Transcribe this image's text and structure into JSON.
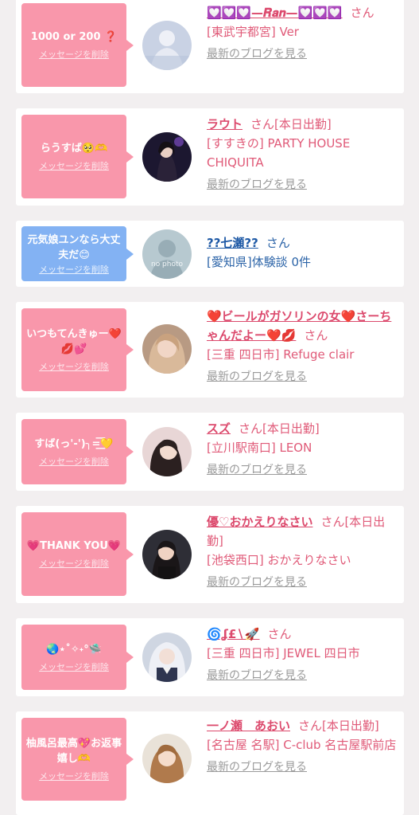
{
  "delete_label": "メッセージを削除",
  "blog_label": "最新のブログを見る",
  "san_label": "さん",
  "colors": {
    "bubble_pink": "#f997ab",
    "bubble_blue": "#83b2f3",
    "text_pink": "#e05a78",
    "text_blue": "#2c64a8"
  },
  "cards": [
    {
      "message": "1000 or 200 ❓",
      "bubble": "pink",
      "name": "💟💟💟—𝑹𝒂𝒏—💟💟💟",
      "suffix": "さん",
      "location": "[東武宇都宮] Ver",
      "avatar": "photo",
      "has_blog": true
    },
    {
      "message": "らうすば🥺🫶",
      "bubble": "pink",
      "name": "ラウト",
      "suffix": "さん[本日出勤]",
      "location": "[すすきの] PARTY HOUSE CHIQUITA",
      "avatar": "photo",
      "has_blog": true
    },
    {
      "message": "元気娘ユンなら大丈夫だ😊",
      "bubble": "blue",
      "name": "??七瀬??",
      "suffix": "さん",
      "location": "[愛知県]体験談 0件",
      "avatar": "no photo",
      "has_blog": false
    },
    {
      "message": "いつもてんきゅー❤️💋💕",
      "bubble": "pink",
      "name": "❤️ビールがガソリンの女❤️さーちゃんだよー❤️💋",
      "suffix": "さん",
      "location": "[三重 四日市] Refuge clair",
      "avatar": "photo",
      "has_blog": true
    },
    {
      "message": "すば(っ'-')╮=͟͟͞͞💛",
      "bubble": "pink",
      "name": "スズ",
      "suffix": "さん[本日出勤]",
      "location": "[立川駅南口] LEON",
      "avatar": "photo",
      "has_blog": true
    },
    {
      "message": "💗THANK YOU💗",
      "bubble": "pink",
      "name": "優♡おかえりなさい",
      "suffix": "さん[本日出勤]",
      "location": "[池袋西口] おかえりなさい",
      "avatar": "photo",
      "has_blog": true
    },
    {
      "message": "🌏⋆˚✧˖°🛸",
      "bubble": "pink",
      "name": "🌀ʆ£∖🚀",
      "suffix": "さん",
      "location": "[三重 四日市] JEWEL 四日市",
      "avatar": "photo",
      "has_blog": true
    },
    {
      "message": "柚風呂最高💖お返事嬉し🫶",
      "bubble": "pink",
      "name": "一ノ瀬　あおい",
      "suffix": "さん[本日出勤]",
      "location": "[名古屋 名駅] C-club 名古屋駅前店",
      "avatar": "photo",
      "has_blog": true
    }
  ]
}
